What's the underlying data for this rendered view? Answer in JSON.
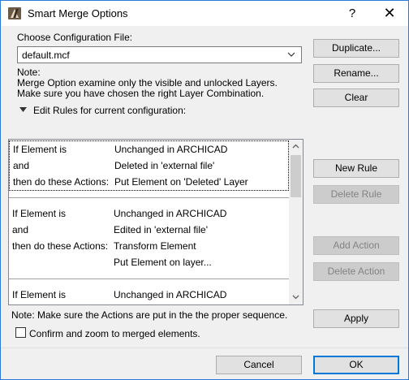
{
  "window": {
    "title": "Smart Merge Options",
    "help_label": "?",
    "close_label": "✕"
  },
  "config": {
    "label": "Choose Configuration File:",
    "value": "default.mcf"
  },
  "note": {
    "line1": "Note:",
    "line2": "Merge Option examine only the visible and unlocked Layers.",
    "line3": "Make sure you have chosen the right Layer Combination."
  },
  "edit_rules": {
    "label": "Edit Rules for current configuration:"
  },
  "buttons": {
    "duplicate": "Duplicate...",
    "rename": "Rename...",
    "clear": "Clear",
    "new_rule": "New Rule",
    "delete_rule": "Delete Rule",
    "add_action": "Add Action",
    "delete_action": "Delete Action",
    "apply": "Apply",
    "cancel": "Cancel",
    "ok": "OK"
  },
  "rules": [
    {
      "rows": [
        {
          "c1": "If Element is",
          "c2": "Unchanged in ARCHICAD"
        },
        {
          "c1": "and",
          "c2": "Deleted in 'external file'"
        },
        {
          "c1": "then do these Actions:",
          "c2": "Put Element on 'Deleted' Layer"
        }
      ]
    },
    {
      "rows": [
        {
          "c1": "If Element is",
          "c2": "Unchanged in ARCHICAD"
        },
        {
          "c1": "and",
          "c2": "Edited in 'external file'"
        },
        {
          "c1": "then do these Actions:",
          "c2": "Transform Element"
        },
        {
          "c1": "",
          "c2": "Put Element on layer..."
        }
      ]
    },
    {
      "rows": [
        {
          "c1": "If Element is",
          "c2": "Unchanged in ARCHICAD"
        }
      ]
    }
  ],
  "sequence_note": "Note: Make sure the Actions are put in the the proper sequence.",
  "confirm_checkbox": {
    "label": "Confirm and zoom to merged elements.",
    "checked": false
  }
}
